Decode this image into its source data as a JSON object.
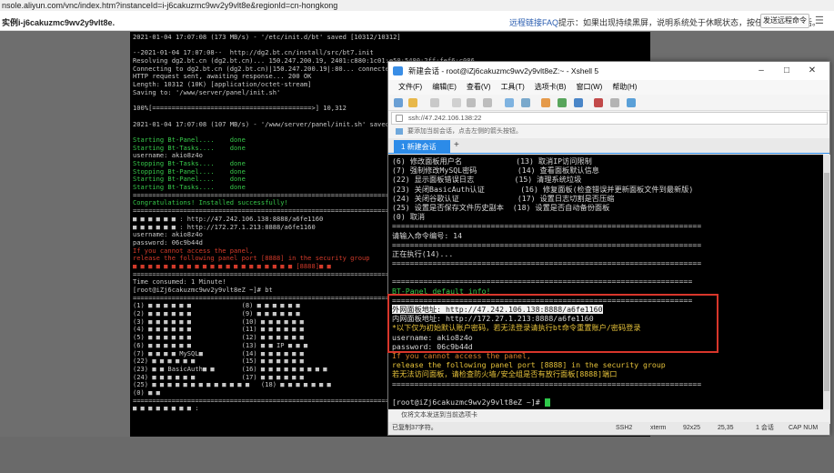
{
  "browser": {
    "url": "nsole.aliyun.com/vnc/index.htm?instanceId=i-j6cakuzmc9wv2y9vlt8e&regionId=cn-hongkong"
  },
  "header": {
    "instance": "实例i-j6cakuzmc9wv2y9vlt8e.",
    "faq": "远程链接FAQ",
    "tip": "提示：如果出现持续黑屏，说明系统处于休眠状态，按任意键可以激活。",
    "send_keys": "发送远程命令"
  },
  "vnc_lines": [
    {
      "t": "2021-01-04 17:07:08 (173 MB/s) - '/etc/init.d/bt' saved [10312/10312]",
      "c": ""
    },
    {
      "t": "",
      "c": ""
    },
    {
      "t": "--2021-01-04 17:07:08--  http://dg2.bt.cn/install/src/bt7.init",
      "c": ""
    },
    {
      "t": "Resolving dg2.bt.cn (dg2.bt.cn)... 150.247.200.19, 2401:c880:1c01:e50:5480:2ff:fef6:c086",
      "c": ""
    },
    {
      "t": "Connecting to dg2.bt.cn (dg2.bt.cn)|150.247.200.19|:80... connected.",
      "c": ""
    },
    {
      "t": "HTTP request sent, awaiting response... 200 OK",
      "c": ""
    },
    {
      "t": "Length: 10312 (10K) [application/octet-stream]",
      "c": ""
    },
    {
      "t": "Saving to: '/www/server/panel/init.sh'",
      "c": ""
    },
    {
      "t": "",
      "c": ""
    },
    {
      "t": "100%[=========================================>] 10,312",
      "c": ""
    },
    {
      "t": "",
      "c": ""
    },
    {
      "t": "2021-01-04 17:07:08 (107 MB/s) - '/www/server/panel/init.sh' saved [10312/10312]",
      "c": ""
    },
    {
      "t": "",
      "c": ""
    },
    {
      "t": "Starting Bt-Panel....    done",
      "c": "g"
    },
    {
      "t": "Starting Bt-Tasks....    done",
      "c": "g"
    },
    {
      "t": "username: akio8z4o",
      "c": ""
    },
    {
      "t": "Stopping Bt-Tasks....    done",
      "c": "g"
    },
    {
      "t": "Stopping Bt-Panel....    done",
      "c": "g"
    },
    {
      "t": "Starting Bt-Panel....    done",
      "c": "g"
    },
    {
      "t": "Starting Bt-Tasks....    done",
      "c": "g"
    },
    {
      "t": "==================================================================",
      "c": ""
    },
    {
      "t": "Congratulations! Installed successfully!",
      "c": "g"
    },
    {
      "t": "==================================================================",
      "c": ""
    },
    {
      "t": "■ ■ ■ ■ ■ ■ : http://47.242.106.138:8888/a6fe1160",
      "c": ""
    },
    {
      "t": "■ ■ ■ ■ ■ ■ : http://172.27.1.213:8888/a6fe1160",
      "c": ""
    },
    {
      "t": "username: akio8z4o",
      "c": ""
    },
    {
      "t": "password: 06c9b44d",
      "c": ""
    },
    {
      "t": "If you cannot access the panel,",
      "c": "r"
    },
    {
      "t": "release the following panel port [8888] in the security group",
      "c": "r"
    },
    {
      "t": "■ ■ ■ ■ ■ ■ ■ ■ ■ ■ ■ ■ ■ ■ ■ ■ ■ ■ ■ ■ ■ [8888]■ ■",
      "c": "r"
    },
    {
      "t": "==================================================================",
      "c": ""
    },
    {
      "t": "Time consumed: 1 Minute!",
      "c": ""
    },
    {
      "t": "[root@iZj6cakuzmc9wv2y9vlt8eZ ~]# bt",
      "c": ""
    },
    {
      "t": "==================================================================",
      "c": ""
    },
    {
      "t": "(1) ■ ■ ■ ■ ■ ■             (8) ■ ■ ■ ■ ■ ■",
      "c": ""
    },
    {
      "t": "(2) ■ ■ ■ ■ ■ ■             (9) ■ ■ ■ ■ ■ ■",
      "c": ""
    },
    {
      "t": "(3) ■ ■ ■ ■ ■ ■             (10) ■ ■ ■ ■ ■ ■",
      "c": ""
    },
    {
      "t": "(4) ■ ■ ■ ■ ■ ■             (11) ■ ■ ■ ■ ■ ■",
      "c": ""
    },
    {
      "t": "(5) ■ ■ ■ ■ ■ ■             (12) ■ ■ ■ ■ ■ ■",
      "c": ""
    },
    {
      "t": "(6) ■ ■ ■ ■ ■ ■             (13) ■ ■ IP ■ ■ ■",
      "c": ""
    },
    {
      "t": "(7) ■ ■ ■ ■ MySQL■          (14) ■ ■ ■ ■ ■ ■",
      "c": ""
    },
    {
      "t": "(22) ■ ■ ■ ■ ■ ■            (15) ■ ■ ■ ■ ■ ■",
      "c": ""
    },
    {
      "t": "(23) ■ ■ BasicAuth■ ■       (16) ■ ■ ■ ■ ■ ■ ■ ■ ■",
      "c": ""
    },
    {
      "t": "(24) ■ ■ ■ ■ ■ ■            (17) ■ ■ ■ ■ ■ ■",
      "c": ""
    },
    {
      "t": "(25) ■ ■ ■ ■ ■ ■ ■ ■ ■ ■ ■ ■ ■   (18) ■ ■ ■ ■ ■ ■ ■",
      "c": ""
    },
    {
      "t": "(0) ■ ■",
      "c": ""
    },
    {
      "t": "==================================================================",
      "c": ""
    },
    {
      "t": "■ ■ ■ ■ ■ ■ ■ ■ :",
      "c": ""
    }
  ],
  "xshell": {
    "title": "新建会话 - root@iZj6cakuzmc9wv2y9vlt8eZ:~ - Xshell 5",
    "menu": [
      "文件(F)",
      "编辑(E)",
      "查看(V)",
      "工具(T)",
      "选项卡(B)",
      "窗口(W)",
      "帮助(H)"
    ],
    "address": "ssh://47.242.106.138:22",
    "hint": "要添加当前会话，点击左侧的箭头按钮。",
    "tab": "1 新建会话",
    "statusbar_left": "仅将文本发送到当前选项卡",
    "statusbar": {
      "host": "已复制37字符。",
      "proto": "SSH2",
      "term": "xterm",
      "size": "92x25",
      "pos": "25,35",
      "sessions": "1 会话",
      "cap": "CAP NUM"
    }
  },
  "xterm_lines": [
    {
      "t": "(6) 修改面板用户名            (13) 取消IP访问限制",
      "c": ""
    },
    {
      "t": "(7) 强制修改MySQL密码         (14) 查看面板默认信息",
      "c": ""
    },
    {
      "t": "(22) 显示面板错误日志         (15) 清理系统垃圾",
      "c": ""
    },
    {
      "t": "(23) 关闭BasicAuth认证        (16) 修复面板(检查错误并更新面板文件到最新版)",
      "c": ""
    },
    {
      "t": "(24) 关闭谷歌认证             (17) 设置日志切割是否压缩",
      "c": ""
    },
    {
      "t": "(25) 设置是否保存文件历史副本  (18) 设置是否自动备份面板",
      "c": ""
    },
    {
      "t": "(0) 取消",
      "c": ""
    },
    {
      "t": "=====================================================================",
      "c": ""
    },
    {
      "t": "请输入命令编号: 14",
      "c": ""
    },
    {
      "t": "=====================================================================",
      "c": ""
    },
    {
      "t": "正在执行(14)...",
      "c": ""
    },
    {
      "t": "=====================================================================",
      "c": ""
    },
    {
      "t": "",
      "c": ""
    },
    {
      "t": "===================================================================",
      "c": ""
    },
    {
      "t": "BT-Panel default info!",
      "c": "g"
    },
    {
      "t": "===================================================================",
      "c": ""
    },
    {
      "t": "外网面板地址: http://47.242.106.138:8888/a6fe1160",
      "c": "",
      "hl": true
    },
    {
      "t": "内网面板地址: http://172.27.1.213:8888/a6fe1160",
      "c": ""
    },
    {
      "t": "*以下仅为初始默认账户密码，若无法登录请执行bt命令重置账户/密码登录",
      "c": "y"
    },
    {
      "t": "username: akio8z4o",
      "c": ""
    },
    {
      "t": "password: 06c9b44d",
      "c": ""
    },
    {
      "t": "If you cannot access the panel,",
      "c": "o"
    },
    {
      "t": "release the following panel port [8888] in the security group",
      "c": "y"
    },
    {
      "t": "若无法访问面板，请检查防火墙/安全组是否有放行面板[8888]端口",
      "c": "y"
    },
    {
      "t": "=====================================================================",
      "c": ""
    },
    {
      "t": "",
      "c": ""
    },
    {
      "t": "[root@iZj6cakuzmc9wv2y9vlt8eZ ~]# ",
      "c": "",
      "cursor": true
    }
  ]
}
